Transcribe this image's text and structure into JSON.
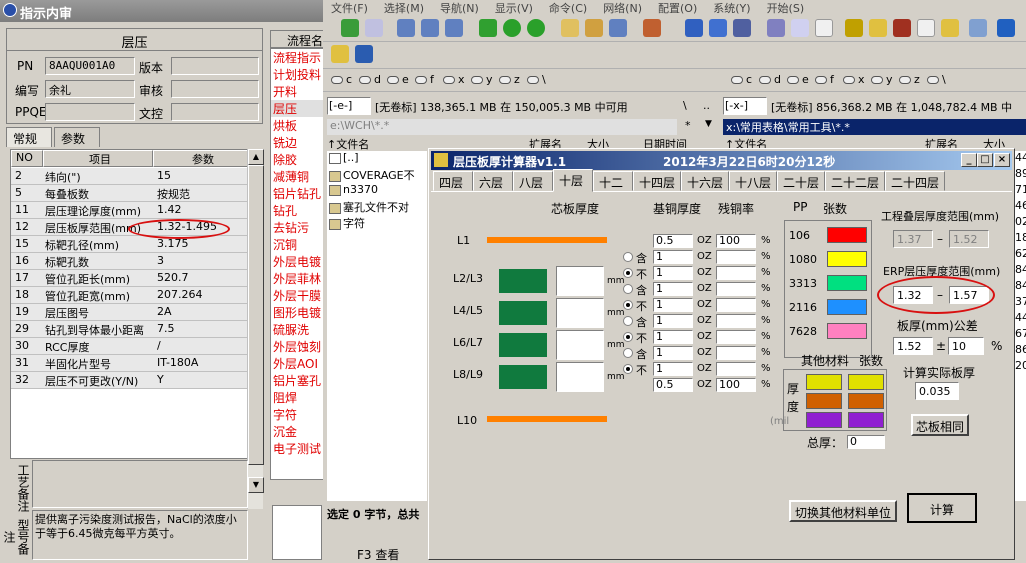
{
  "left": {
    "title": "指示内审",
    "section": "层压",
    "pn_label": "PN",
    "pn_value": "8AAQU001A0",
    "version_label": "版本",
    "author_label": "编写",
    "author_value": "余礼",
    "review_label": "审核",
    "ppqe_label": "PPQE",
    "doc_label": "文控",
    "tabs": [
      "常规",
      "参数"
    ],
    "grid_headers": [
      "NO",
      "项目",
      "参数"
    ],
    "rows": [
      {
        "no": "2",
        "item": "纬向(\")",
        "val": "15"
      },
      {
        "no": "5",
        "item": "每叠板数",
        "val": "按规范"
      },
      {
        "no": "11",
        "item": "层压理论厚度(mm)",
        "val": "1.42"
      },
      {
        "no": "12",
        "item": "层压板厚范围(mm)",
        "val": "1.32-1.495"
      },
      {
        "no": "15",
        "item": "标靶孔径(mm)",
        "val": "3.175"
      },
      {
        "no": "16",
        "item": "标靶孔数",
        "val": "3"
      },
      {
        "no": "17",
        "item": "管位孔距长(mm)",
        "val": "520.7"
      },
      {
        "no": "18",
        "item": "管位孔距宽(mm)",
        "val": "207.264"
      },
      {
        "no": "19",
        "item": "层压图号",
        "val": "2A"
      },
      {
        "no": "29",
        "item": "钻孔到导体最小距离",
        "val": "7.5"
      },
      {
        "no": "30",
        "item": "RCC厚度",
        "val": "/"
      },
      {
        "no": "31",
        "item": "半固化片型号",
        "val": "IT-180A"
      },
      {
        "no": "32",
        "item": "层压不可更改(Y/N)",
        "val": "Y"
      }
    ],
    "remark_label_1": "工艺备注",
    "remark_label_2": "型号备注",
    "remark_text": "提供离子污染度测试报告，NaCl的浓度小于等于6.45微克每平方英寸。"
  },
  "process": {
    "header": "流程名",
    "items": [
      "流程指示",
      "计划投料",
      "开料",
      "层压",
      "烘板",
      "铣边",
      "除胶",
      "减薄铜",
      "铝片钻孔",
      "钻孔",
      "去钻污",
      "沉铜",
      "外层电镀",
      "外层菲林",
      "外层干膜",
      "图形电镀",
      "硫脲洗",
      "外层蚀刻",
      "外层AOI",
      "铝片塞孔",
      "阻焊",
      "字符",
      "沉金",
      "电子测试"
    ]
  },
  "fm": {
    "menu": [
      "文件(F)",
      "选择(M)",
      "导航(N)",
      "显示(V)",
      "命令(C)",
      "网络(N)",
      "配置(O)",
      "系统(Y)",
      "开始(S)"
    ],
    "drives": [
      "c",
      "d",
      "e",
      "f",
      "x",
      "y",
      "z",
      "\\"
    ],
    "left_drive": "[-e-]",
    "left_info": "[无卷标]  138,365.1 MB 在 150,005.3 MB 中可用",
    "right_drive": "[-x-]",
    "right_info": "[无卷标]  856,368.2 MB 在 1,048,782.4 MB 中",
    "left_path": "e:\\WCH\\*.*",
    "right_path": "x:\\常用表格\\常用工具\\*.*",
    "col_name": "↑文件名",
    "col_ext": "扩展名",
    "col_size": "大小",
    "col_date": "日期时间",
    "files": [
      "[..]",
      "COVERAGE不",
      "n3370",
      "塞孔文件不对",
      "字符"
    ],
    "status": "选定 0 字节，总共",
    "f3": "F3 查看",
    "right_nums": [
      "44",
      "89",
      "71",
      "46",
      "02",
      "18",
      "62",
      "84",
      "84",
      "37",
      "44",
      "67",
      "86",
      "20"
    ]
  },
  "dialog": {
    "title": "层压板厚计算器v1.1",
    "datetime": "2012年3月22日6时20分12秒",
    "tabs": [
      "四层",
      "六层",
      "八层",
      "十层",
      "十二",
      "十四层",
      "十六层",
      "十八层",
      "二十层",
      "二十二层",
      "二十四层"
    ],
    "selected_tab": "十层",
    "core_thk_label": "芯板厚度",
    "base_cu_label": "基铜厚度",
    "residual_label": "残铜率",
    "pp_label": "PP",
    "sheets_label": "张数",
    "layers": [
      "L1",
      "L2/L3",
      "L4/L5",
      "L6/L7",
      "L8/L9",
      "L10"
    ],
    "mm": "mm",
    "opt_yes": "含",
    "opt_no": "不",
    "oz": "OZ",
    "pct": "%",
    "copper_rows": [
      {
        "cu": "0.5",
        "res": "100"
      },
      {
        "cu": "1",
        "res": ""
      },
      {
        "cu": "1",
        "res": ""
      },
      {
        "cu": "1",
        "res": ""
      },
      {
        "cu": "1",
        "res": ""
      },
      {
        "cu": "1",
        "res": ""
      },
      {
        "cu": "1",
        "res": ""
      },
      {
        "cu": "1",
        "res": ""
      },
      {
        "cu": "1",
        "res": ""
      },
      {
        "cu": "0.5",
        "res": "100"
      }
    ],
    "pp_types": [
      {
        "name": "106",
        "color": "#ff0000"
      },
      {
        "name": "1080",
        "color": "#ffff00"
      },
      {
        "name": "3313",
        "color": "#00e080"
      },
      {
        "name": "2116",
        "color": "#1e90ff"
      },
      {
        "name": "7628",
        "color": "#ff80c0"
      }
    ],
    "other_label": "其他材料",
    "other_sheets_label": "张数",
    "thick_label_1": "厚",
    "thick_label_2": "度",
    "thick_unit": "(mil",
    "other_colors": [
      "#e0e000",
      "#d06000",
      "#9020d0"
    ],
    "total_label": "总厚：",
    "total_value": "0",
    "switch_btn": "切换其他材料单位",
    "calc_btn": "计算",
    "eng_range_label": "工程叠层厚度范围(mm)",
    "eng_min": "1.37",
    "eng_max": "1.52",
    "erp_range_label": "ERP层压厚度范围(mm)",
    "erp_min": "1.32",
    "erp_max": "1.57",
    "tol_label": "板厚(mm)公差",
    "tol_thk": "1.52",
    "tol_pct": "10",
    "pm": "±",
    "dash": "–",
    "actual_label": "计算实际板厚",
    "actual_value": "0.035",
    "same_core_btn": "芯板相同"
  }
}
